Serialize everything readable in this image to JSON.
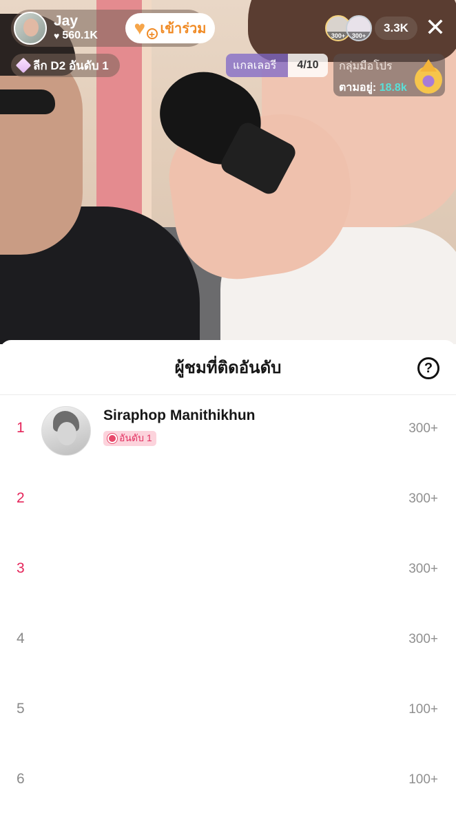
{
  "host": {
    "name": "Jay",
    "likes": "560.1K",
    "join_label": "เข้าร่วม"
  },
  "league": {
    "label": "ลีก D2 อันดับ 1"
  },
  "viewers": {
    "avatars": [
      {
        "badge": "300+"
      },
      {
        "badge": "300+"
      }
    ],
    "count": "3.3K"
  },
  "gallery": {
    "label": "แกลเลอรี",
    "count": "4/10"
  },
  "pro_group": {
    "title": "กลุ่มมือโปร",
    "follow_label": "ตามอยู่:",
    "follow_count": "18.8k"
  },
  "sheet": {
    "title": "ผู้ชมที่ติดอันดับ",
    "rows": [
      {
        "rank": "1",
        "name": "Siraphop Manithikhun",
        "badge": "อันดับ 1",
        "score": "300+"
      },
      {
        "rank": "2",
        "score": "300+"
      },
      {
        "rank": "3",
        "score": "300+"
      },
      {
        "rank": "4",
        "score": "300+"
      },
      {
        "rank": "5",
        "score": "100+"
      },
      {
        "rank": "6",
        "score": "100+"
      }
    ]
  },
  "colors": {
    "accent_rank": "#e5255a",
    "join_text": "#f08a24",
    "follow_count": "#59e0d8",
    "badge_bg": "#fcd3dc"
  }
}
